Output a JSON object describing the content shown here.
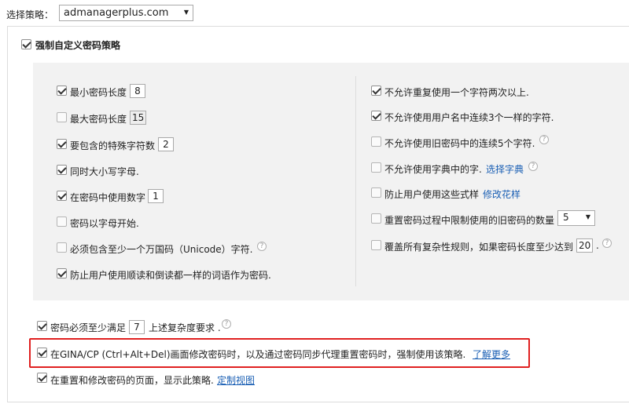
{
  "header": {
    "policy_label": "选择策略：",
    "policy_value": "admanagerplus.com"
  },
  "enforce": {
    "label": "强制自定义密码策略",
    "checked": true
  },
  "left_rules": [
    {
      "label": "最小密码长度",
      "checked": true,
      "value": "8"
    },
    {
      "label": "最大密码长度",
      "checked": false,
      "value": "15"
    },
    {
      "label": "要包含的特殊字符数",
      "checked": true,
      "value": "2"
    },
    {
      "label": "同时大小写字母.",
      "checked": true
    },
    {
      "label": "在密码中使用数字",
      "checked": true,
      "value": "1"
    },
    {
      "label": "密码以字母开始.",
      "checked": false
    },
    {
      "label": "必须包含至少一个万国码（Unicode）字符.",
      "checked": false
    },
    {
      "label": "防止用户使用顺读和倒读都一样的词语作为密码.",
      "checked": true
    }
  ],
  "right_rules": [
    {
      "label": "不允许重复使用一个字符两次以上.",
      "checked": true
    },
    {
      "label": "不允许使用用户名中连续3个一样的字符.",
      "checked": true
    },
    {
      "label": "不允许使用旧密码中的连续5个字符.",
      "checked": false
    },
    {
      "label": "不允许使用字典中的字.",
      "checked": false,
      "link": "选择字典"
    },
    {
      "label": "防止用户使用这些式样",
      "checked": false,
      "link": "修改花样"
    },
    {
      "label": "重置密码过程中限制使用的旧密码的数量",
      "checked": false,
      "select": "5"
    },
    {
      "label": "覆盖所有复杂性规则，如果密码长度至少达到",
      "checked": false,
      "value": "20",
      "suffix": "."
    }
  ],
  "bottom": {
    "complexity_prefix": "密码必须至少满足",
    "complexity_value": "7",
    "complexity_suffix": "上述复杂度要求 .",
    "gina_label": "在GINA/CP (Ctrl+Alt+Del)画面修改密码时，以及通过密码同步代理重置密码时，强制使用该策略.",
    "gina_link": "了解更多",
    "display_label": "在重置和修改密码的页面，显示此策略.",
    "display_link": "定制视图"
  },
  "icons": {
    "help": "help-circle-icon",
    "dropdown": "chevron-down-icon",
    "checkbox": "checkbox-icon"
  },
  "colors": {
    "link": "#1a5fb4",
    "highlight_border": "#e02020",
    "panel_bg": "#f2f2f2"
  }
}
